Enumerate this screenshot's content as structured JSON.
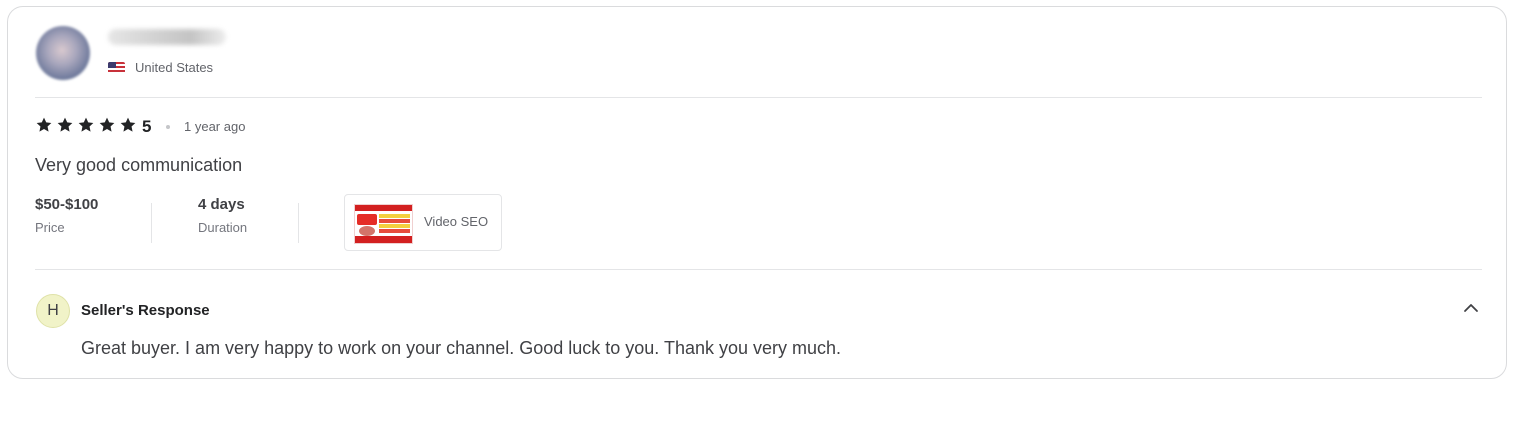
{
  "reviewer": {
    "country": "United States",
    "flag_icon": "us-flag-icon"
  },
  "review": {
    "stars": 5,
    "rating_label": "5",
    "time_ago": "1 year ago",
    "text": "Very good communication"
  },
  "order": {
    "price_value": "$50-$100",
    "price_label": "Price",
    "duration_value": "4 days",
    "duration_label": "Duration"
  },
  "gig": {
    "title": "Video SEO"
  },
  "seller_response": {
    "avatar_initial": "H",
    "title": "Seller's Response",
    "text": "Great buyer. I am very happy to work on your channel. Good luck to you. Thank you very much.",
    "toggle_icon": "chevron-up-icon"
  },
  "colors": {
    "star": "#222325",
    "text": "#404145",
    "muted": "#62646a",
    "border": "#dadbdd",
    "seller_avatar_bg": "#f1f3c8"
  }
}
